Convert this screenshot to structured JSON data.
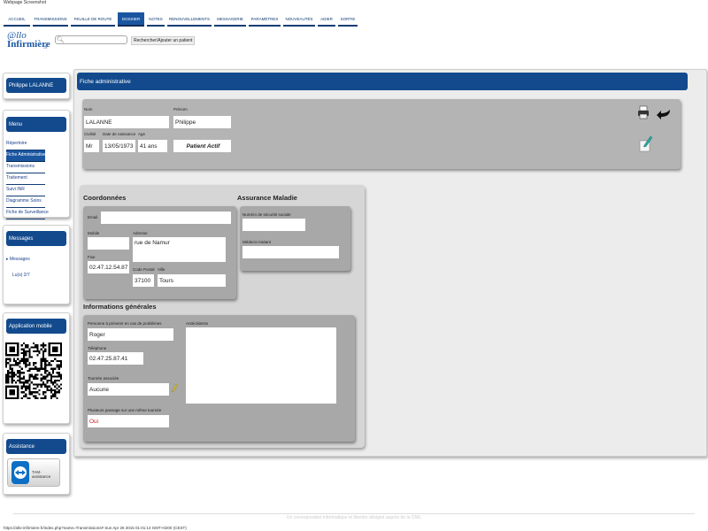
{
  "window": {
    "caption": "Webpage Screenshot"
  },
  "nav": {
    "tabs": [
      {
        "label": "ACCUEIL",
        "active": false
      },
      {
        "label": "TRANSMISSIONS",
        "active": false
      },
      {
        "label": "FEUILLE DE ROUTE",
        "active": false
      },
      {
        "label": "DOSSIER",
        "active": true
      },
      {
        "label": "NOTES",
        "active": false
      },
      {
        "label": "RENOUVELLEMENTS",
        "active": false
      },
      {
        "label": "MESSAGERIE",
        "active": false
      },
      {
        "label": "PARAMÈTRES",
        "active": false
      },
      {
        "label": "NOUVEAUTÉS",
        "active": false
      },
      {
        "label": "AIDER",
        "active": false
      },
      {
        "label": "SORTIE",
        "active": false
      }
    ]
  },
  "logo": {
    "line1": "@llo",
    "line2": "Infirmière",
    "suffix": ".fr"
  },
  "search": {
    "placeholder": "",
    "button_label": "Rechercher/Ajouter un patient"
  },
  "sidebar": {
    "patient_name": "Philippe LALANNE",
    "menu_title": "Menu",
    "menu_items": [
      {
        "label": "Répertoire",
        "active": false
      },
      {
        "label": "Fiche Administrative",
        "active": true
      },
      {
        "label": "Transmissions",
        "active": false
      },
      {
        "label": "Traitement",
        "active": false
      },
      {
        "label": "Suivi INR",
        "active": false
      },
      {
        "label": "Diagramme Soins",
        "active": false
      },
      {
        "label": "Fiche de Surveillance",
        "active": false
      }
    ],
    "messages_title": "Messages",
    "messages_link": "Messages",
    "messages_count": "Lu(s) 2/7",
    "app_title": "Application mobile",
    "assistance_title": "Assistance",
    "assistance_label": "TAM-assistance"
  },
  "main": {
    "title": "Fiche administrative",
    "admin": {
      "nom_label": "Nom",
      "nom": "LALANNE",
      "prenom_label": "Prénom",
      "prenom": "Philippe",
      "civilite_label": "Civilité",
      "civilite": "Mr",
      "naissance_label": "Date de naissance",
      "naissance": "13/05/1973",
      "age_label": "Age",
      "age": "41 ans",
      "statut": "Patient Actif"
    },
    "coordonnees": {
      "title": "Coordonnées",
      "email_label": "Email",
      "email": "",
      "mobile_label": "Mobile",
      "mobile": "",
      "adresse_label": "Adresse",
      "adresse": "rue de Namur",
      "fixe_label": "Fixe",
      "fixe": "02.47.12.54.87",
      "cp_label": "Code Postal",
      "cp": "37100",
      "ville_label": "Ville",
      "ville": "Tours"
    },
    "assurance": {
      "title": "Assurance Maladie",
      "secu_label": "Numéro de sécurité sociale",
      "secu": "",
      "medecin_label": "Médecin traitant",
      "medecin": ""
    },
    "infos": {
      "title": "Informations générales",
      "personne_label": "Personne à prévenir en cas de problèmes",
      "personne": "Roger",
      "tel_label": "Téléphone",
      "tel": "02.47.25.87.41",
      "tournee_label": "Tournée associée",
      "tournee": "Aucune",
      "plusieurs_label": "Plusieurs passage sur une même tournée",
      "plusieurs": "Oui",
      "antecedents_label": "Antécédents",
      "antecedents": ""
    }
  },
  "footer": {
    "text": "Un correspondant informatique et libertés désigné auprès de la CNIL"
  },
  "status_bar": {
    "text": "https://allo-infirmiere.fr/index.php?name=Transmissions# Sun Apr 26 2015 01:01:14 GMT+0200 (CEST)"
  }
}
